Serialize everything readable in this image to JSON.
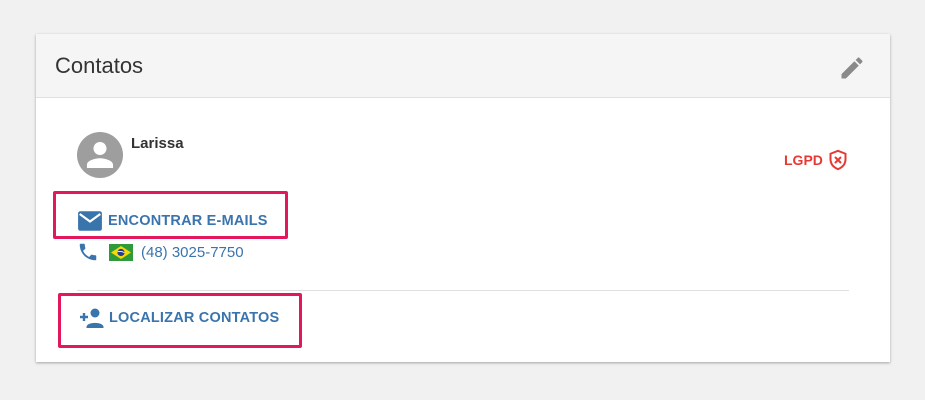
{
  "card": {
    "title": "Contatos",
    "edit_icon": "pencil-icon"
  },
  "contact": {
    "name": "Larissa",
    "avatar_icon": "person-icon",
    "lgpd_label": "LGPD",
    "lgpd_icon": "shield-x-icon",
    "email_action": "ENCONTRAR E-MAILS",
    "email_icon": "envelope-icon",
    "phone_icon": "phone-icon",
    "phone_flag": "brazil-flag-icon",
    "phone_number": "(48) 3025-7750"
  },
  "footer": {
    "find_contacts_label": "LOCALIZAR CONTATOS",
    "find_contacts_icon": "add-person-icon"
  },
  "colors": {
    "link": "#3a74ad",
    "lgpd": "#e53935",
    "highlight": "#e3175b",
    "header_bg": "#f5f5f5",
    "page_bg": "#f1f1f1"
  }
}
